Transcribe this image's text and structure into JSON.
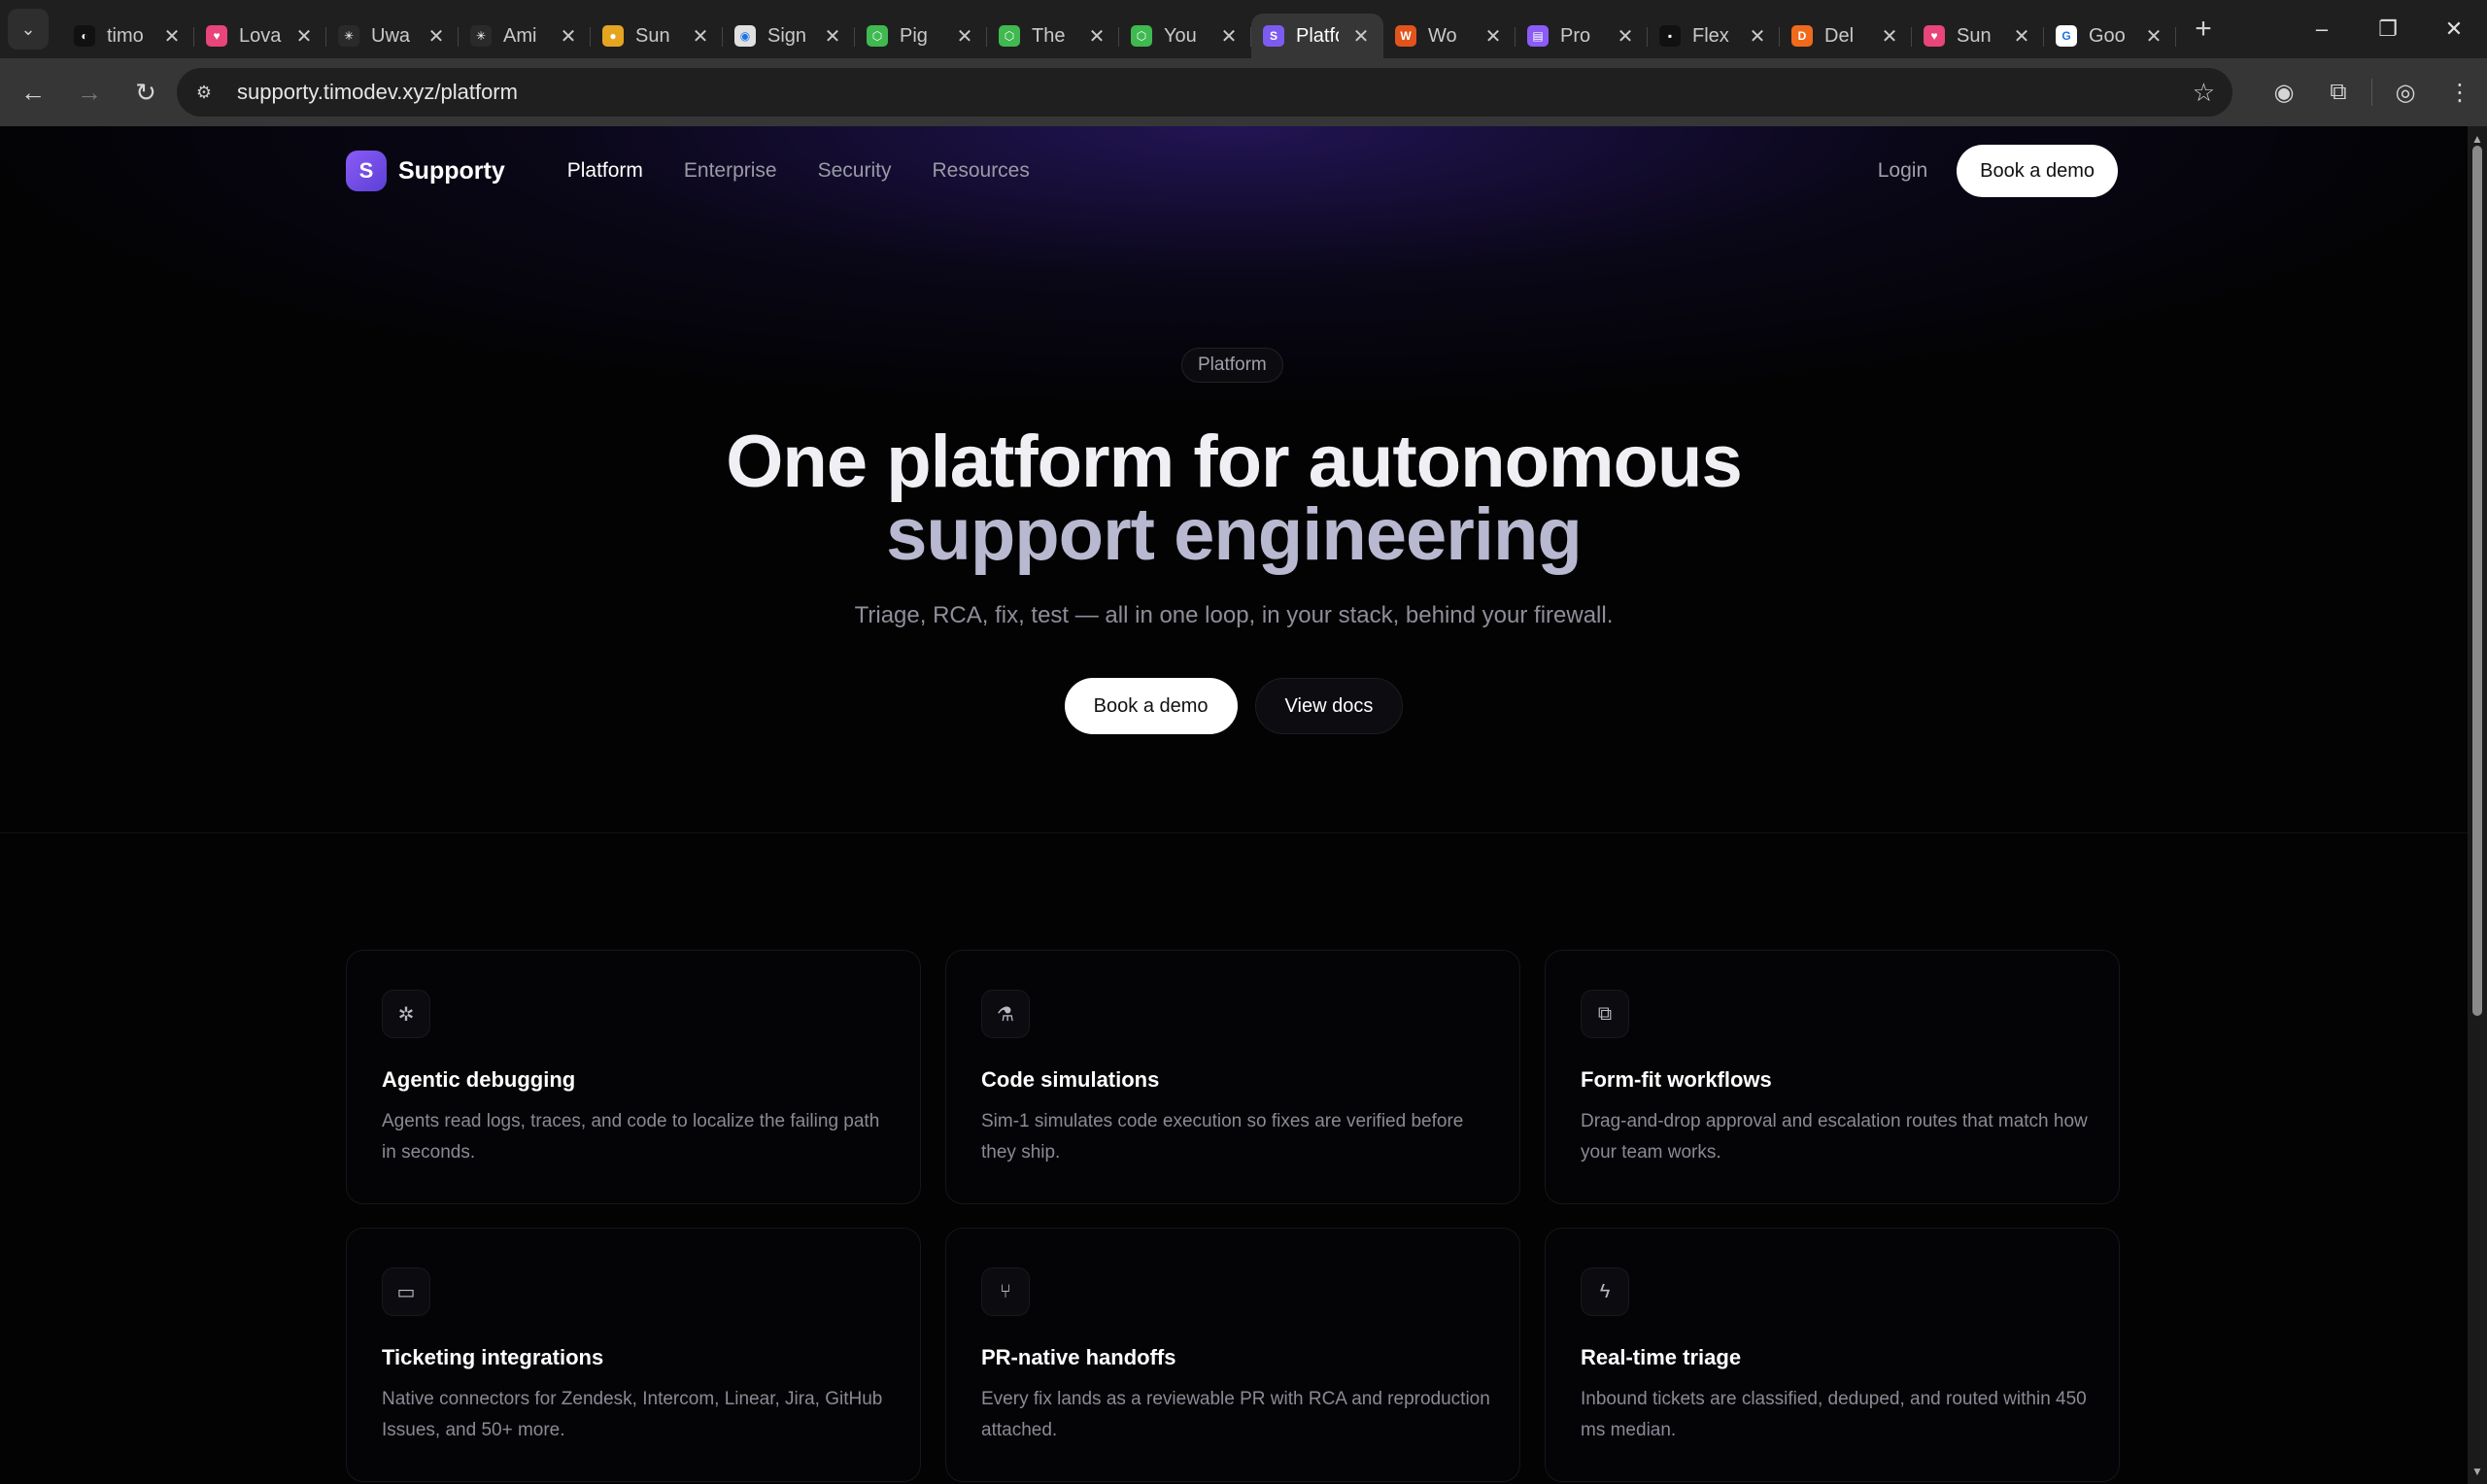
{
  "browser": {
    "tabs": [
      {
        "title": "timo",
        "favicon_color": "#111111",
        "favicon_glyph": "◐"
      },
      {
        "title": "Lovable",
        "favicon_color": "#e8457a",
        "favicon_glyph": "♥"
      },
      {
        "title": "Uwa",
        "favicon_color": "#2a2a2a",
        "favicon_glyph": "✳"
      },
      {
        "title": "Ami",
        "favicon_color": "#2a2a2a",
        "favicon_glyph": "✳"
      },
      {
        "title": "Sun",
        "favicon_color": "#e6a520",
        "favicon_glyph": "●"
      },
      {
        "title": "Sign",
        "favicon_color": "#e0e0e0",
        "favicon_glyph": "◉"
      },
      {
        "title": "Pig",
        "favicon_color": "#3fb950",
        "favicon_glyph": "⬡"
      },
      {
        "title": "The",
        "favicon_color": "#3fb950",
        "favicon_glyph": "⬡"
      },
      {
        "title": "You",
        "favicon_color": "#3fb950",
        "favicon_glyph": "⬡"
      },
      {
        "title": "Platform",
        "favicon_color": "#7c5cf0",
        "favicon_glyph": "S"
      },
      {
        "title": "Wo",
        "favicon_color": "#e2541c",
        "favicon_glyph": "W"
      },
      {
        "title": "Pro",
        "favicon_color": "#8b5cf6",
        "favicon_glyph": "▤"
      },
      {
        "title": "Flex",
        "favicon_color": "#111111",
        "favicon_glyph": "▪"
      },
      {
        "title": "Del",
        "favicon_color": "#f06a1c",
        "favicon_glyph": "D"
      },
      {
        "title": "Sun",
        "favicon_color": "#e8457a",
        "favicon_glyph": "♥"
      },
      {
        "title": "Goo",
        "favicon_color": "#ffffff",
        "favicon_glyph": "G"
      }
    ],
    "active_tab_index": 9,
    "url": "supporty.timodev.xyz/platform"
  },
  "site": {
    "logo_letter": "S",
    "brand": "Supporty",
    "nav": [
      {
        "label": "Platform",
        "active": true
      },
      {
        "label": "Enterprise",
        "active": false
      },
      {
        "label": "Security",
        "active": false
      },
      {
        "label": "Resources",
        "active": false
      }
    ],
    "login_label": "Login",
    "demo_label": "Book a demo"
  },
  "hero": {
    "pill": "Platform",
    "title_line1": "One platform for autonomous",
    "title_line2": "support engineering",
    "subtitle": "Triage, RCA, fix, test — all in one loop, in your stack, behind your firewall.",
    "cta_primary": "Book a demo",
    "cta_secondary": "View docs"
  },
  "features": [
    {
      "icon": "bug-icon",
      "title": "Agentic debugging",
      "desc": "Agents read logs, traces, and code to localize the failing path in seconds."
    },
    {
      "icon": "flask-icon",
      "title": "Code simulations",
      "desc": "Sim-1 simulates code execution so fixes are verified before they ship."
    },
    {
      "icon": "workflow-icon",
      "title": "Form-fit workflows",
      "desc": "Drag-and-drop approval and escalation routes that match how your team works."
    },
    {
      "icon": "chat-icon",
      "title": "Ticketing integrations",
      "desc": "Native connectors for Zendesk, Intercom, Linear, Jira, GitHub Issues, and 50+ more."
    },
    {
      "icon": "git-branch-icon",
      "title": "PR-native handoffs",
      "desc": "Every fix lands as a reviewable PR with RCA and reproduction attached."
    },
    {
      "icon": "bolt-icon",
      "title": "Real-time triage",
      "desc": "Inbound tickets are classified, deduped, and routed within 450 ms median."
    }
  ],
  "colors": {
    "accent": "#7c5cf0",
    "background": "#030304",
    "hero_title": "#f0f0f4",
    "hero_title_secondary": "#b8b8d0"
  }
}
